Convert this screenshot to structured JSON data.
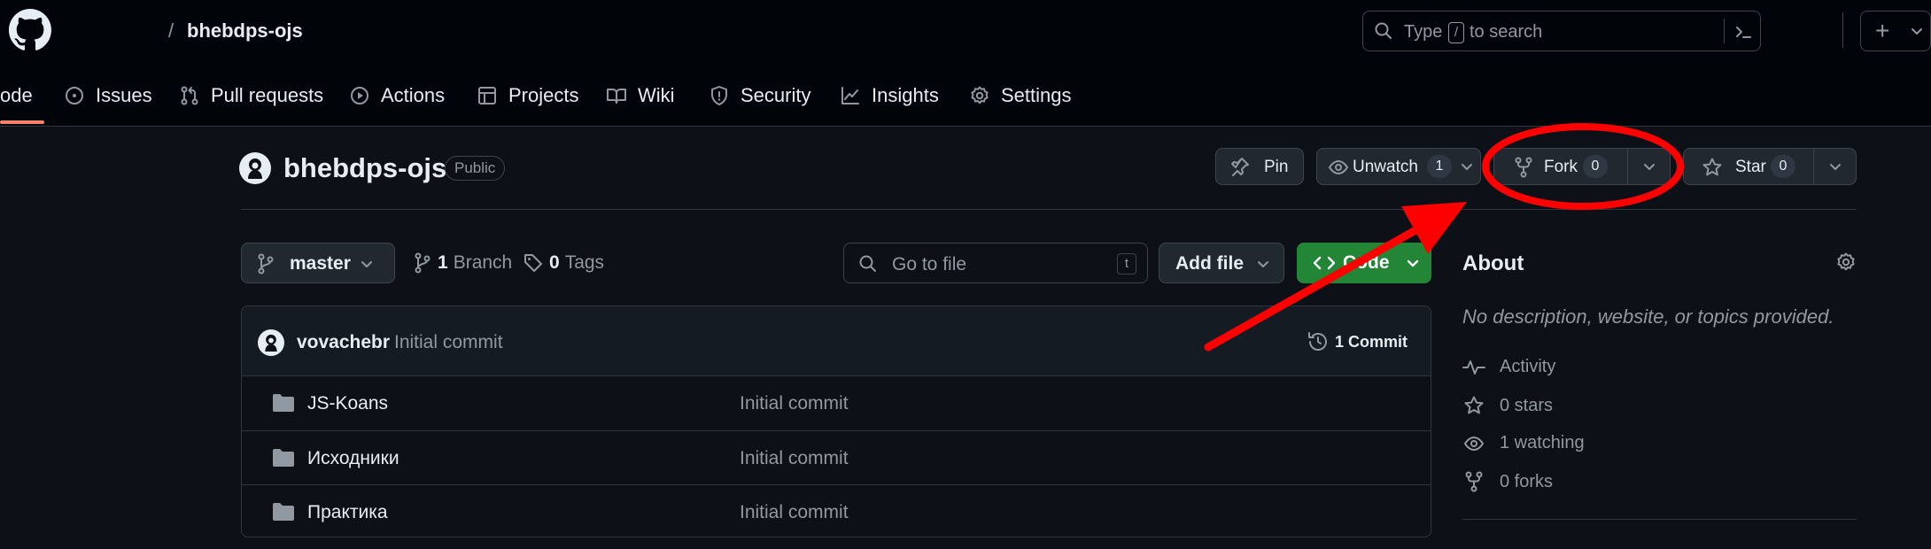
{
  "header": {
    "breadcrumb_slash": "/",
    "repo_link": "bhebdps-ojs",
    "search": {
      "prefix": "Type",
      "key": "/",
      "suffix": "to search"
    },
    "plus_label": "+"
  },
  "tabs": [
    {
      "label": "ode",
      "icon": "code-icon"
    },
    {
      "label": "Issues",
      "icon": "issue-icon"
    },
    {
      "label": "Pull requests",
      "icon": "pull-request-icon"
    },
    {
      "label": "Actions",
      "icon": "play-icon"
    },
    {
      "label": "Projects",
      "icon": "table-icon"
    },
    {
      "label": "Wiki",
      "icon": "book-icon"
    },
    {
      "label": "Security",
      "icon": "shield-icon"
    },
    {
      "label": "Insights",
      "icon": "graph-icon"
    },
    {
      "label": "Settings",
      "icon": "gear-icon"
    }
  ],
  "repo": {
    "name": "bhebdps-ojs",
    "visibility": "Public",
    "pin_label": "Pin",
    "watch_label": "Unwatch",
    "watch_count": "1",
    "fork_label": "Fork",
    "fork_count": "0",
    "star_label": "Star",
    "star_count": "0"
  },
  "toolbar": {
    "branch": "master",
    "branch_count": "1",
    "branch_label": "Branch",
    "tag_count": "0",
    "tag_label": "Tags",
    "go_to_file_placeholder": "Go to file",
    "go_to_file_key": "t",
    "add_file_label": "Add file",
    "code_label": "Code"
  },
  "commit": {
    "author": "vovachebr",
    "message": "Initial commit",
    "count_label": "1 Commit"
  },
  "files": [
    {
      "name": "JS-Koans",
      "message": "Initial commit"
    },
    {
      "name": "Исходники",
      "message": "Initial commit"
    },
    {
      "name": "Практика",
      "message": "Initial commit"
    }
  ],
  "about": {
    "title": "About",
    "description": "No description, website, or topics provided.",
    "items": [
      {
        "icon": "pulse-icon",
        "value": "Activity"
      },
      {
        "icon": "star-icon",
        "value": "0 stars"
      },
      {
        "icon": "eye-icon",
        "value": "1 watching"
      },
      {
        "icon": "fork-icon",
        "value": "0 forks"
      }
    ]
  },
  "colors": {
    "background": "#0d1117",
    "header_background": "#010409",
    "accent_green": "#238636",
    "annotation_red": "#ff0000",
    "tab_underline": "#f78166"
  }
}
